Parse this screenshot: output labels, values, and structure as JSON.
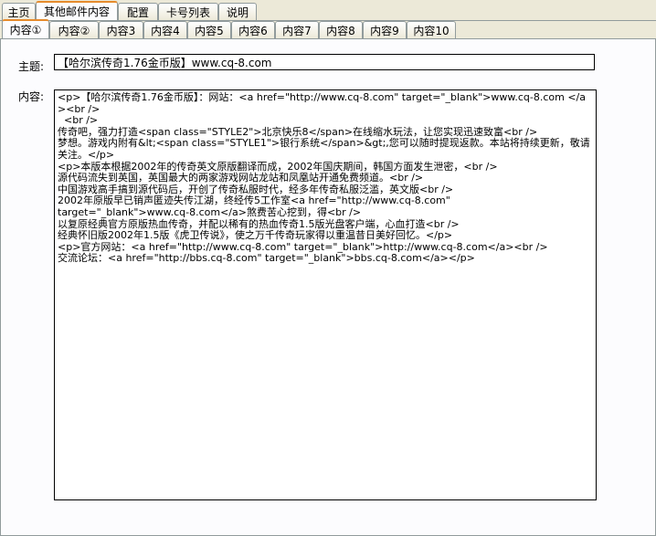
{
  "main_tabs": [
    "主页",
    "其他邮件内容",
    "配置",
    "卡号列表",
    "说明"
  ],
  "main_active": 1,
  "sub_tabs": [
    "内容①",
    "内容②",
    "内容3",
    "内容4",
    "内容5",
    "内容6",
    "内容7",
    "内容8",
    "内容9",
    "内容10"
  ],
  "sub_active": 0,
  "form": {
    "subject_label": "主题:",
    "subject_value": "【哈尔滨传奇1.76金币版】www.cq-8.com",
    "content_label": "内容:",
    "content_value": "<p>【哈尔滨传奇1.76金币版】：网站：<a href=\"http://www.cq-8.com\" target=\"_blank\">www.cq-8.com </a><br />\n  <br />\n传奇吧，强力打造<span class=\"STYLE2\">北京快乐8</span>在线缩水玩法，让您实现迅速致富<br />\n梦想。游戏内附有&lt;<span class=\"STYLE1\">银行系统</span>&gt;,您可以随时提现返款。本站将持续更新，敬请关注。</p>\n<p>本版本根据2002年的传奇英文原版翻译而成，2002年国庆期间，韩国方面发生泄密，<br />\n源代码流失到英国，英国最大的两家游戏网站龙站和凤凰站开通免费频道。<br />\n中国游戏高手搞到源代码后，开创了传奇私服时代，经多年传奇私服泛滥，英文版<br />\n2002年原版早已销声匿迹失传江湖，终经传5工作室<a href=\"http://www.cq-8.com\"\ntarget=\"_blank\">www.cq-8.com</a>煞费苦心挖到，得<br />\n以复原经典官方原版热血传奇，并配以稀有的热血传奇1.5版光盘客户端，心血打造<br />\n经典怀旧版2002年1.5版《虎卫传说》，使之万千传奇玩家得以重温昔日美好回忆。</p>\n<p>官方网站：<a href=\"http://www.cq-8.com\" target=\"_blank\">http://www.cq-8.com</a><br />\n交流论坛：<a href=\"http://bbs.cq-8.com\" target=\"_blank\">bbs.cq-8.com</a></p>"
  }
}
